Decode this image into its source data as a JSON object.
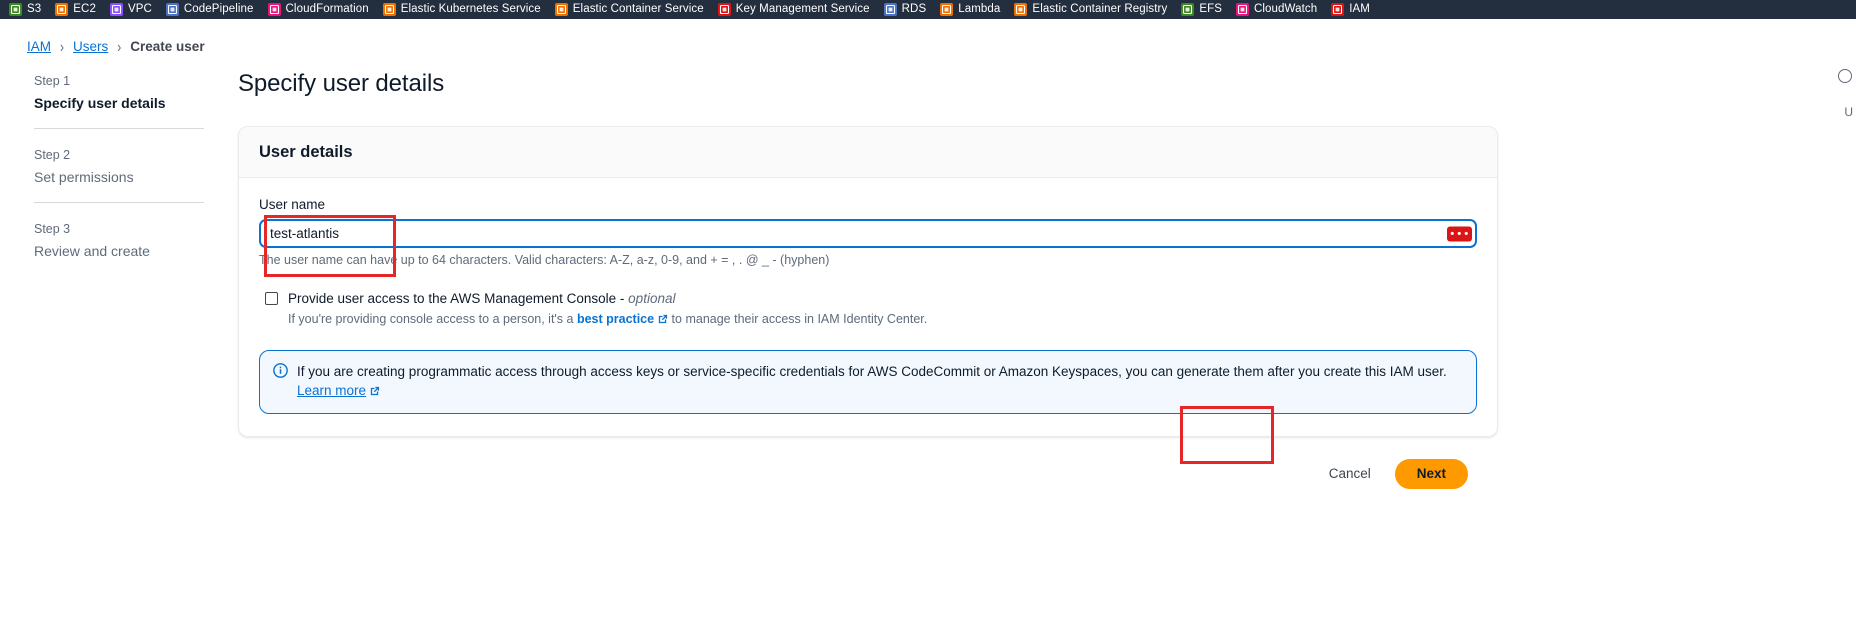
{
  "service_bar": {
    "items": [
      {
        "label": "S3",
        "icon": "s3-icon",
        "color": "#3f8624",
        "glyph": ""
      },
      {
        "label": "EC2",
        "icon": "ec2-icon",
        "color": "#ed7100",
        "glyph": ""
      },
      {
        "label": "VPC",
        "icon": "vpc-icon",
        "color": "#8c4fff",
        "glyph": ""
      },
      {
        "label": "CodePipeline",
        "icon": "codepipeline-icon",
        "color": "#4d72c3",
        "glyph": ""
      },
      {
        "label": "CloudFormation",
        "icon": "cloudformation-icon",
        "color": "#e7157b",
        "glyph": ""
      },
      {
        "label": "Elastic Kubernetes Service",
        "icon": "elastic-kubernetes-service-icon",
        "color": "#ed7100",
        "glyph": ""
      },
      {
        "label": "Elastic Container Service",
        "icon": "elastic-container-service-icon",
        "color": "#ed7100",
        "glyph": ""
      },
      {
        "label": "Key Management Service",
        "icon": "key-management-service-icon",
        "color": "#d91515",
        "glyph": ""
      },
      {
        "label": "RDS",
        "icon": "rds-icon",
        "color": "#4d72c3",
        "glyph": ""
      },
      {
        "label": "Lambda",
        "icon": "lambda-icon",
        "color": "#ed7100",
        "glyph": ""
      },
      {
        "label": "Elastic Container Registry",
        "icon": "elastic-container-registry-icon",
        "color": "#ed7100",
        "glyph": ""
      },
      {
        "label": "EFS",
        "icon": "efs-icon",
        "color": "#3f8624",
        "glyph": ""
      },
      {
        "label": "CloudWatch",
        "icon": "cloudwatch-icon",
        "color": "#e7157b",
        "glyph": ""
      },
      {
        "label": "IAM",
        "icon": "iam-icon",
        "color": "#d91515",
        "glyph": ""
      }
    ]
  },
  "breadcrumb": {
    "items": [
      {
        "label": "IAM",
        "link": true
      },
      {
        "label": "Users",
        "link": true
      },
      {
        "label": "Create user",
        "link": false
      }
    ],
    "separator": "›"
  },
  "wizard": {
    "steps": [
      {
        "number": "Step 1",
        "title": "Specify user details",
        "active": true
      },
      {
        "number": "Step 2",
        "title": "Set permissions",
        "active": false
      },
      {
        "number": "Step 3",
        "title": "Review and create",
        "active": false
      }
    ]
  },
  "page": {
    "title": "Specify user details"
  },
  "user_details": {
    "header": "User details",
    "username_label": "User name",
    "username_value": "test-atlantis",
    "username_placeholder": "",
    "username_badge": "•••",
    "username_hint": "The user name can have up to 64 characters. Valid characters: A-Z, a-z, 0-9, and + = , . @ _ - (hyphen)",
    "console_access_checked": false,
    "console_access_label": "Provide user access to the AWS Management Console - ",
    "console_access_optional": "optional",
    "console_access_desc_pre": "If you're providing console access to a person, it's a ",
    "console_access_link": "best practice",
    "console_access_desc_post": " to manage their access in IAM Identity Center.",
    "info_text": "If you are creating programmatic access through access keys or service-specific credentials for AWS CodeCommit or Amazon Keyspaces, you can generate them after you create this IAM user. ",
    "info_link": "Learn more"
  },
  "actions": {
    "cancel_label": "Cancel",
    "next_label": "Next"
  },
  "colors": {
    "accent_blue": "#0972d3",
    "nav_bg": "#232f3e",
    "primary_button": "#ff9900",
    "annotation_red": "#e62727",
    "badge_red": "#d91515"
  }
}
